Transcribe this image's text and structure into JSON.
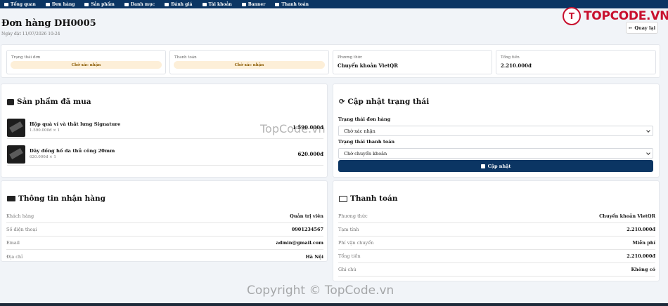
{
  "nav": {
    "items": [
      "Tổng quan",
      "Đơn hàng",
      "Sản phẩm",
      "Danh mục",
      "Đánh giá",
      "Tài khoản",
      "Banner",
      "Thanh toán"
    ]
  },
  "header": {
    "title": "Đơn hàng DH0005",
    "date": "Ngày đặt 11/07/2026 10:24",
    "back_label": "Quay lại"
  },
  "logo": {
    "mark": "T",
    "text": "TOPCODE.VN"
  },
  "status_cards": [
    {
      "label": "Trạng thái đơn",
      "value": "Chờ xác nhận"
    },
    {
      "label": "Thanh toán",
      "value": "Chờ xác nhận"
    },
    {
      "label": "Phương thức",
      "value": "Chuyển khoản VietQR"
    },
    {
      "label": "Tổng tiền",
      "value": "2.210.000đ"
    }
  ],
  "products": {
    "title": "Sản phẩm đã mua",
    "items": [
      {
        "name": "Hộp quà ví và thắt lưng Signature",
        "meta": "1.590.000đ × 1",
        "price": "1.590.000đ"
      },
      {
        "name": "Dây đồng hồ da thủ công 20mm",
        "meta": "620.000đ × 1",
        "price": "620.000đ"
      }
    ]
  },
  "update": {
    "title": "Cập nhật trạng thái",
    "order_status_label": "Trạng thái đơn hàng",
    "order_status_value": "Chờ xác nhận",
    "payment_status_label": "Trạng thái thanh toán",
    "payment_status_value": "Chờ chuyển khoản",
    "button_label": "Cập nhật"
  },
  "shipping": {
    "title": "Thông tin nhận hàng",
    "rows": [
      {
        "key": "Khách hàng",
        "value": "Quản trị viên"
      },
      {
        "key": "Số điện thoại",
        "value": "0901234567"
      },
      {
        "key": "Email",
        "value": "admin@gmail.com"
      },
      {
        "key": "Địa chỉ",
        "value": "Hà Nội"
      }
    ]
  },
  "payment": {
    "title": "Thanh toán",
    "rows": [
      {
        "key": "Phương thức",
        "value": "Chuyển khoản VietQR"
      },
      {
        "key": "Tạm tính",
        "value": "2.210.000đ"
      },
      {
        "key": "Phí vận chuyển",
        "value": "Miễn phí"
      },
      {
        "key": "Tổng tiền",
        "value": "2.210.000đ"
      },
      {
        "key": "Ghi chú",
        "value": "Không có"
      }
    ]
  },
  "watermarks": {
    "center": "TopCode.vn",
    "bottom": "Copyright © TopCode.vn"
  }
}
